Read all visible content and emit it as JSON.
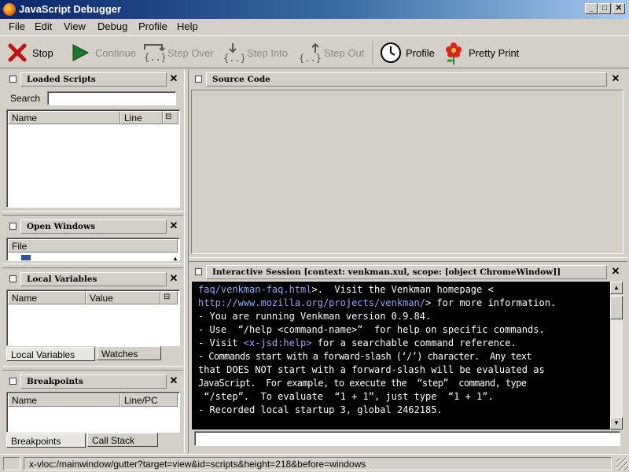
{
  "window": {
    "title": "JavaScript Debugger",
    "minimize": "_",
    "maximize": "□",
    "close": "✕"
  },
  "menu": [
    "File",
    "Edit",
    "View",
    "Debug",
    "Profile",
    "Help"
  ],
  "toolbar": {
    "stop": "Stop",
    "continue": "Continue",
    "step_over": "Step Over",
    "step_into": "Step Into",
    "step_out": "Step Out",
    "profile": "Profile",
    "pretty_print": "Pretty Print"
  },
  "loaded_scripts": {
    "title": "Loaded Scripts",
    "search_label": "Search",
    "search_value": "",
    "columns": [
      "Name",
      "Line"
    ]
  },
  "open_windows": {
    "title": "Open Windows",
    "columns": [
      "File"
    ]
  },
  "local_variables": {
    "title": "Local Variables",
    "columns": [
      "Name",
      "Value"
    ],
    "tabs": [
      "Local Variables",
      "Watches"
    ]
  },
  "breakpoints": {
    "title": "Breakpoints",
    "columns": [
      "Name",
      "Line/PC"
    ],
    "tabs": [
      "Breakpoints",
      "Call Stack"
    ]
  },
  "source_code": {
    "title": "Source Code"
  },
  "interactive_session": {
    "title": "Interactive Session [context: venkman.xul, scope: [object ChromeWindow]]",
    "lines": {
      "l1_link": "faq/venkman-faq.html",
      "l1_text": ">.  Visit the Venkman homepage <",
      "l2_link": "http://www.mozilla.org/projects/venkman/",
      "l2_text": "> for more information.",
      "l3": "- You are running Venkman version 0.9.84.",
      "l4": "- Use  “/help <command-name>”  for help on specific commands.",
      "l5_a": "- Visit ",
      "l5_link": "<x-jsd:help>",
      "l5_b": " for a searchable command reference.",
      "l6": "- Commands start with a forward-slash (‘/’) character.  Any text",
      "l7": "that DOES NOT start with a forward-slash will be evaluated as",
      "l8": "JavaScript.  For example, to execute the  “step”  command, type",
      "l9": " “/step”.  To evaluate  “1 + 1”, just type  “1 + 1”.",
      "l10": "- Recorded local startup 3, global 2462185."
    },
    "input_value": ""
  },
  "status": {
    "text": "x-vloc:/mainwindow/gutter?target=view&id=scripts&height=218&before=windows"
  },
  "colors": {
    "titlebar_start": "#0a246a",
    "titlebar_end": "#a6caf0",
    "console_bg": "#000000",
    "link": "#8faaff",
    "chrome": "#d4d0c8"
  }
}
